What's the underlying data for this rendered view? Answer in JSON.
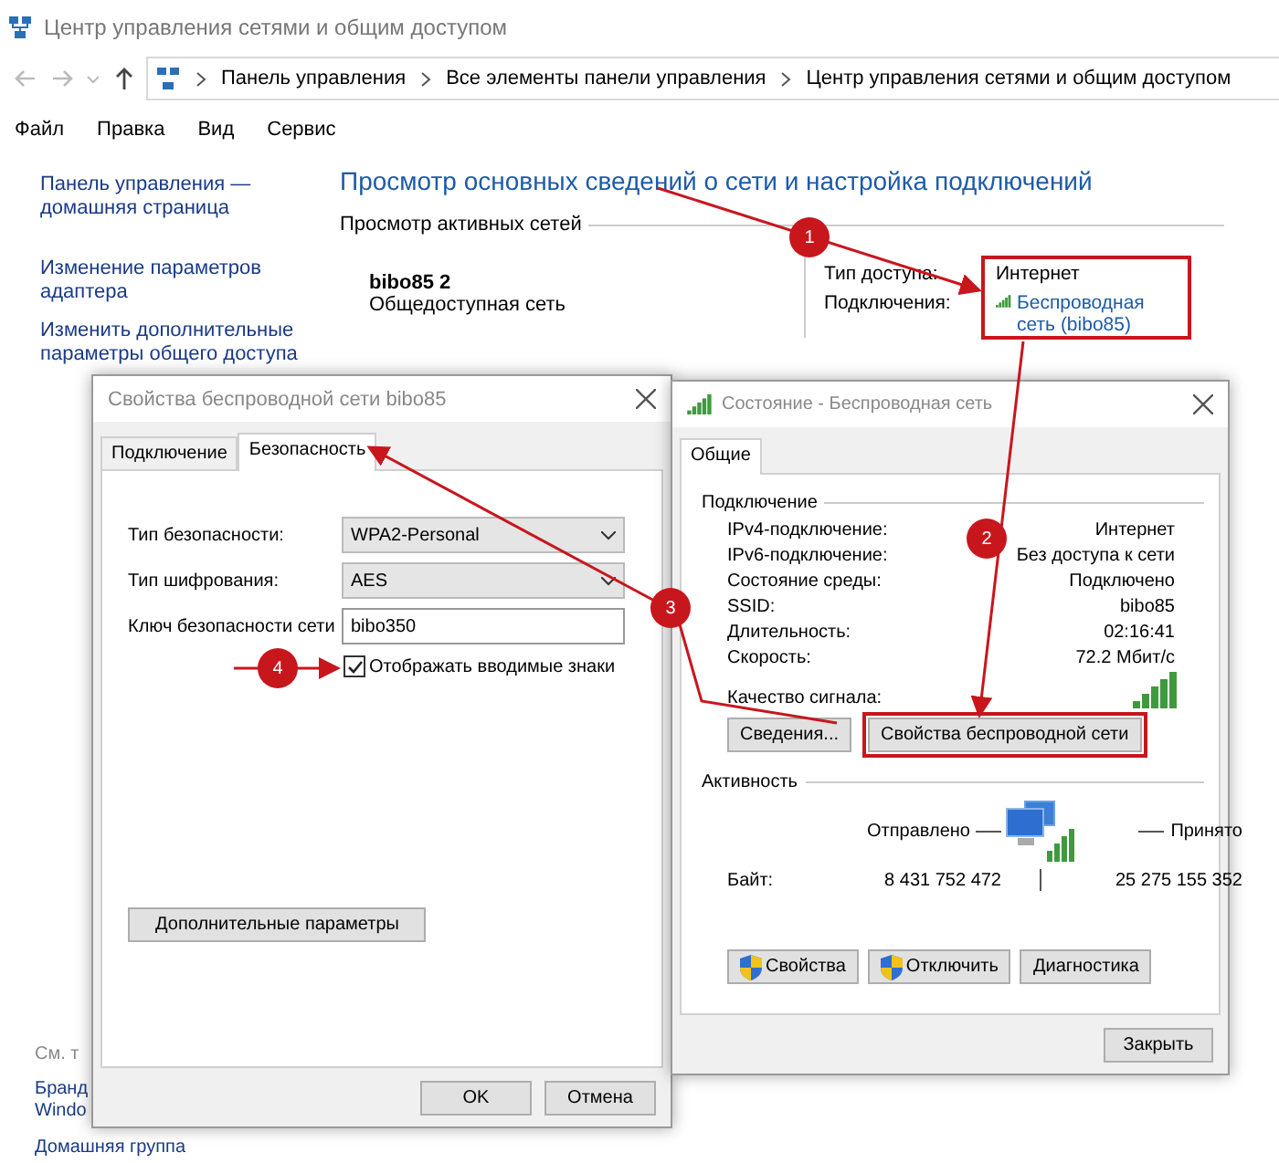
{
  "window": {
    "title": "Центр управления сетями и общим доступом"
  },
  "address_bar": {
    "breadcrumbs": [
      "Панель управления",
      "Все элементы панели управления",
      "Центр управления сетями и общим доступом"
    ]
  },
  "menu": [
    "Файл",
    "Правка",
    "Вид",
    "Сервис"
  ],
  "sidebar": {
    "links": [
      "Панель управления — домашняя страница",
      "Изменение параметров адаптера",
      "Изменить дополнительные параметры общего доступа"
    ],
    "see_also": {
      "heading": "См. т",
      "links": [
        {
          "lines": [
            "Бранд",
            "Windo"
          ]
        },
        {
          "lines": [
            "Домашняя группа"
          ]
        }
      ]
    }
  },
  "main": {
    "heading": "Просмотр основных сведений о сети и настройка подключений",
    "section_title": "Просмотр активных сетей",
    "network": {
      "name": "bibo85  2",
      "category": "Общедоступная сеть"
    },
    "access": {
      "label": "Тип доступа:",
      "value": "Интернет"
    },
    "connections": {
      "label": "Подключения:",
      "link": "Беспроводная сеть (bibo85)"
    }
  },
  "wireless_properties": {
    "title": "Свойства беспроводной сети bibo85",
    "tabs": [
      {
        "label": "Подключение",
        "selected": false
      },
      {
        "label": "Безопасность",
        "selected": true
      }
    ],
    "fields": [
      {
        "label": "Тип безопасности:",
        "kind": "dropdown",
        "value": "WPA2-Personal"
      },
      {
        "label": "Тип шифрования:",
        "kind": "dropdown",
        "value": "AES"
      },
      {
        "label": "Ключ безопасности сети",
        "kind": "text",
        "value": "bibo350"
      }
    ],
    "show_chars": {
      "label": "Отображать вводимые знаки",
      "checked": true
    },
    "advanced_button": "Дополнительные параметры",
    "buttons": [
      "OK",
      "Отмена"
    ]
  },
  "status": {
    "title": "Состояние - Беспроводная сеть",
    "tabs": [
      {
        "label": "Общие",
        "selected": true
      }
    ],
    "connection_heading": "Подключение",
    "rows": [
      {
        "label": "IPv4-подключение:",
        "value": "Интернет"
      },
      {
        "label": "IPv6-подключение:",
        "value": "Без доступа к сети"
      },
      {
        "label": "Состояние среды:",
        "value": "Подключено"
      },
      {
        "label": "SSID:",
        "value": "bibo85"
      },
      {
        "label": "Длительность:",
        "value": "02:16:41"
      },
      {
        "label": "Скорость:",
        "value": "72.2 Мбит/с"
      }
    ],
    "signal_label": "Качество сигнала:",
    "buttons": [
      "Сведения...",
      "Свойства беспроводной сети"
    ],
    "activity": {
      "heading": "Активность",
      "sent_label": "Отправлено",
      "received_label": "Принято",
      "bytes_label": "Байт:",
      "sent": "8 431 752 472",
      "received": "25 275 155 352"
    },
    "action_buttons": [
      {
        "label": "Свойства",
        "shield": true
      },
      {
        "label": "Отключить",
        "shield": true
      },
      {
        "label": "Диагностика",
        "shield": false
      }
    ],
    "close_button": "Закрыть"
  },
  "callouts": [
    {
      "number": "1"
    },
    {
      "number": "2"
    },
    {
      "number": "3"
    },
    {
      "number": "4"
    }
  ]
}
